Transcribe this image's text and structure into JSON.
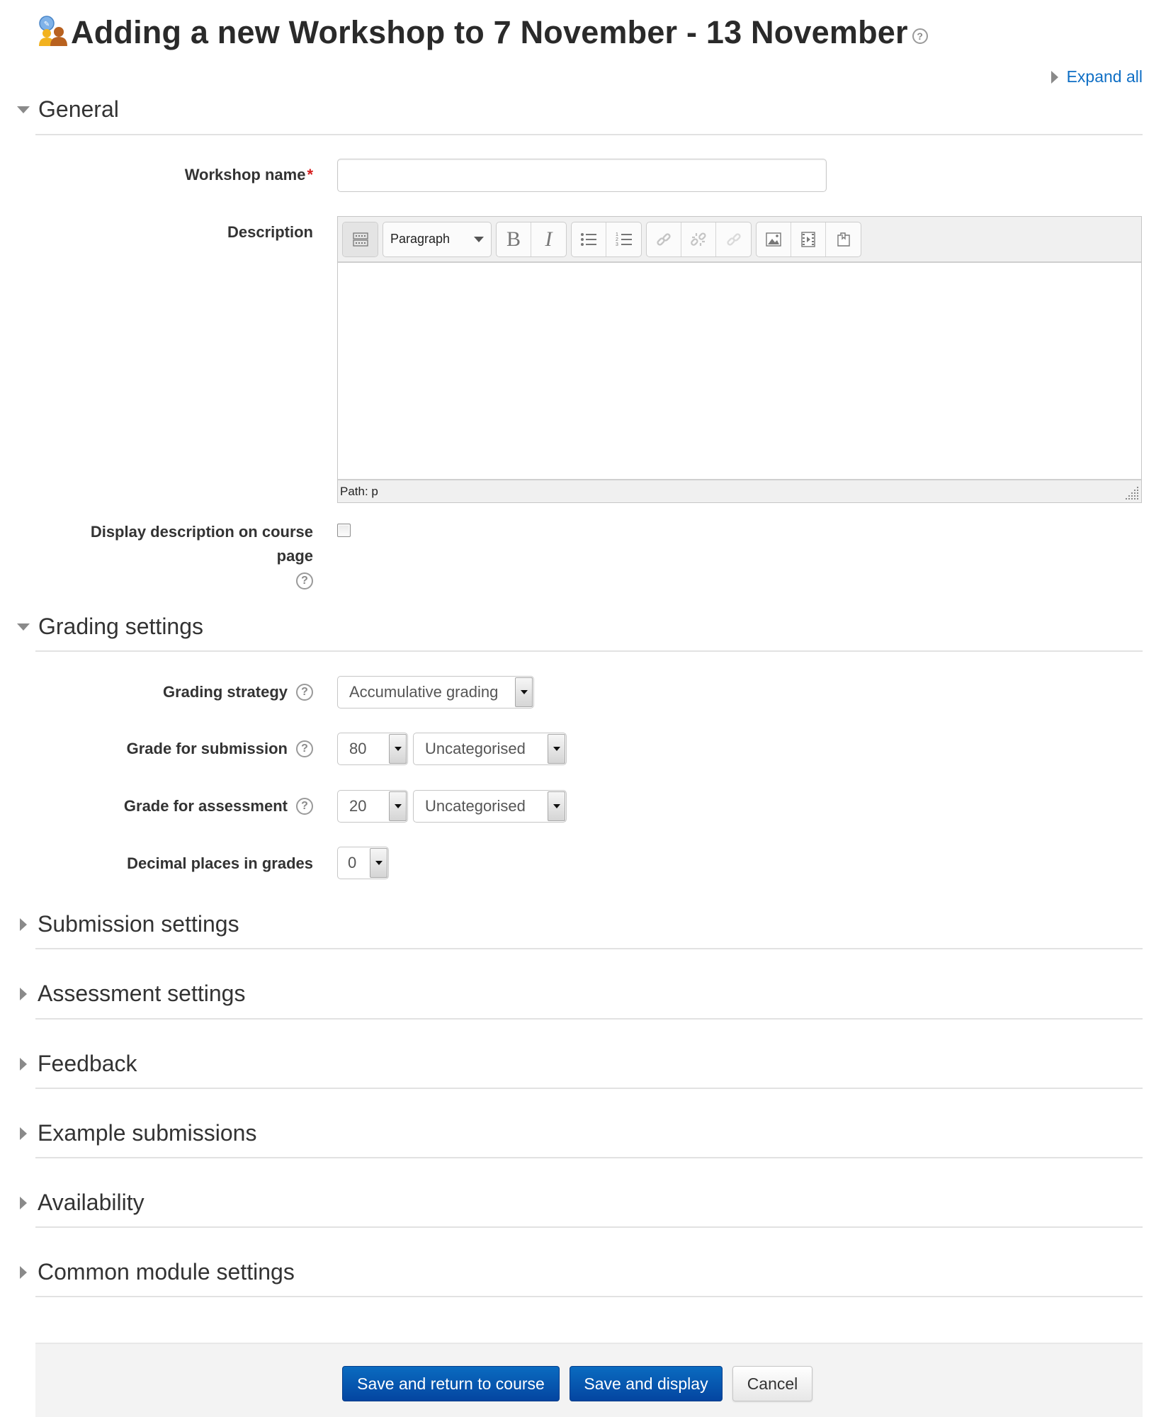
{
  "page": {
    "title": "Adding a new Workshop to 7 November - 13 November",
    "title_icon": "workshop-icon",
    "title_help_icon": "help-icon",
    "expand_all_label": "Expand all"
  },
  "sections": {
    "general": {
      "label": "General",
      "state": "expanded"
    },
    "grading": {
      "label": "Grading settings",
      "state": "expanded"
    },
    "collapsed": [
      {
        "label": "Submission settings",
        "state": "collapsed"
      },
      {
        "label": "Assessment settings",
        "state": "collapsed"
      },
      {
        "label": "Feedback",
        "state": "collapsed"
      },
      {
        "label": "Example submissions",
        "state": "collapsed"
      },
      {
        "label": "Availability",
        "state": "collapsed"
      },
      {
        "label": "Common module settings",
        "state": "collapsed"
      }
    ]
  },
  "general": {
    "workshop_name": {
      "label": "Workshop name",
      "required_marker": "*",
      "value": "",
      "placeholder": ""
    },
    "description": {
      "label": "Description",
      "toolbar": {
        "toggle_icon": "toolbar-toggle-icon",
        "format_select": "Paragraph",
        "bold": "B",
        "italic": "I",
        "buttons": [
          "unordered-list-icon",
          "ordered-list-icon",
          "link-icon",
          "unlink-icon",
          "anchor-icon",
          "image-icon",
          "media-icon",
          "manage-files-icon"
        ],
        "disabled": [
          "link-icon",
          "unlink-icon",
          "anchor-icon"
        ]
      },
      "content": "",
      "path": "Path: p"
    },
    "display_description": {
      "label_line1": "Display description on course",
      "label_line2": "page",
      "checked": false
    }
  },
  "grading": {
    "strategy": {
      "label": "Grading strategy",
      "value": "Accumulative grading"
    },
    "grade_submission": {
      "label": "Grade for submission",
      "value": "80",
      "category": "Uncategorised"
    },
    "grade_assessment": {
      "label": "Grade for assessment",
      "value": "20",
      "category": "Uncategorised"
    },
    "decimal_places": {
      "label": "Decimal places in grades",
      "value": "0"
    }
  },
  "footer": {
    "save_return": "Save and return to course",
    "save_display": "Save and display",
    "cancel": "Cancel"
  },
  "colors": {
    "link": "#0f6fc5",
    "primary_button": "#0a5bb5",
    "required": "#d61e1e"
  }
}
